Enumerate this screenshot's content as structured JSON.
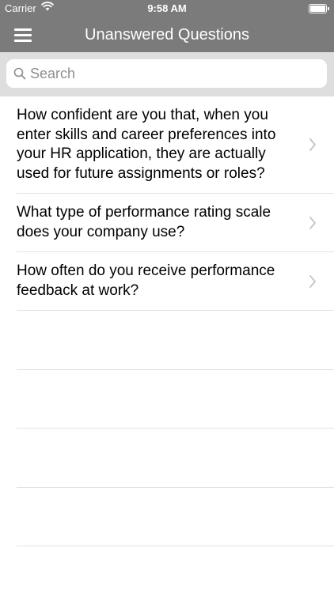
{
  "status_bar": {
    "carrier": "Carrier",
    "time": "9:58 AM"
  },
  "nav": {
    "title": "Unanswered Questions",
    "menu_icon": "hamburger-menu-icon"
  },
  "search": {
    "placeholder": "Search",
    "value": ""
  },
  "questions": [
    {
      "text": "How confident are you that, when you enter skills and career preferences into your HR application, they are actually used for future assignments or roles?"
    },
    {
      "text": "What type of performance rating scale does your company use?"
    },
    {
      "text": "How often do you receive performance feedback at work?"
    }
  ],
  "colors": {
    "nav_background": "#7b7b7b",
    "search_background": "#dedede",
    "separator": "#e2e2e2"
  }
}
